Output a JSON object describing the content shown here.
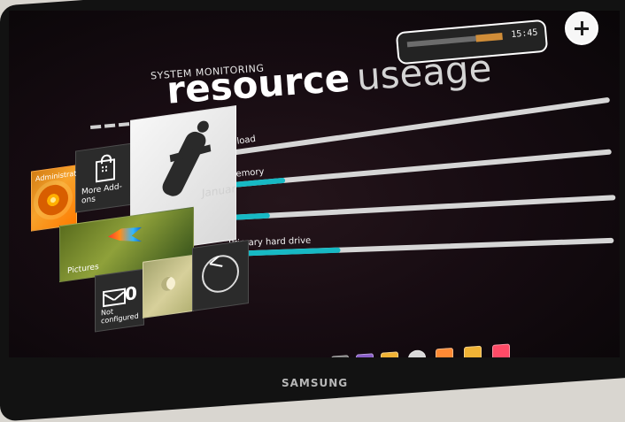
{
  "brand": "SAMSUNG",
  "header": {
    "kicker": "SYSTEM MONITORING",
    "title_part_1": "resource",
    "title_part_2": "useage"
  },
  "top_widget": {
    "text": "15:45"
  },
  "resources": [
    {
      "label": "Processor load",
      "value": 0.08
    },
    {
      "label": "System memory",
      "value": 0.22
    },
    {
      "label": "",
      "value": 0.14
    },
    {
      "label": "Primary hard drive",
      "value": 0.29
    }
  ],
  "tiles": {
    "administrator": "Administrator",
    "more_addons": "More Add-ons",
    "photo_text": "January",
    "pictures": "Pictures",
    "mail_count": "0",
    "not_configured": "Not configured"
  },
  "icons": {
    "plus": "plus-icon",
    "bag": "bag-icon",
    "mail": "mail-icon",
    "moon": "moon-icon",
    "clock": "clock-icon"
  },
  "colors": {
    "accent": "#17b9c4",
    "background": "#170c12"
  }
}
